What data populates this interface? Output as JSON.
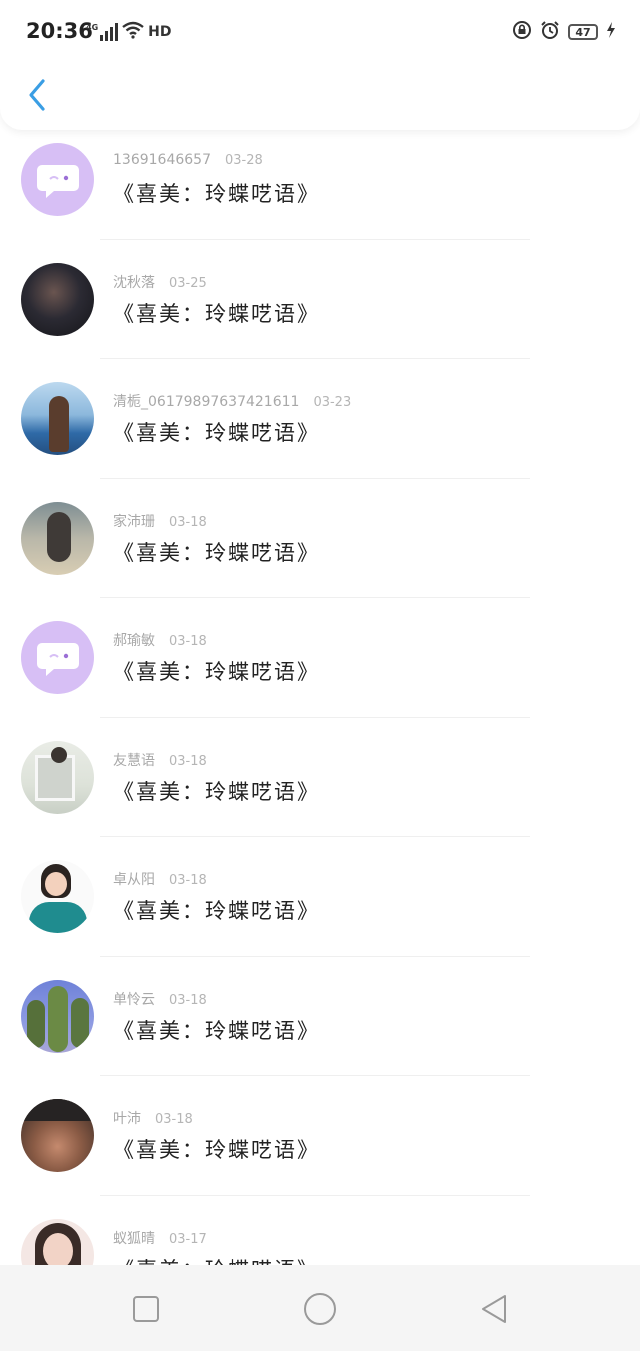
{
  "status_bar": {
    "time": "20:36",
    "network": "4G",
    "hd": "HD",
    "battery": "47"
  },
  "items": [
    {
      "author": "13691646657",
      "date": "03-28",
      "title": "《喜美：玲蝶呓语》",
      "avatar": "default-chat-avatar"
    },
    {
      "author": "沈秋落",
      "date": "03-25",
      "title": "《喜美：玲蝶呓语》",
      "avatar": "photo-avatar"
    },
    {
      "author": "清栀_06179897637421611",
      "date": "03-23",
      "title": "《喜美：玲蝶呓语》",
      "avatar": "photo-avatar"
    },
    {
      "author": "家沛珊",
      "date": "03-18",
      "title": "《喜美：玲蝶呓语》",
      "avatar": "photo-avatar"
    },
    {
      "author": "郝瑜敏",
      "date": "03-18",
      "title": "《喜美：玲蝶呓语》",
      "avatar": "default-chat-avatar"
    },
    {
      "author": "友慧语",
      "date": "03-18",
      "title": "《喜美：玲蝶呓语》",
      "avatar": "photo-avatar"
    },
    {
      "author": "卓从阳",
      "date": "03-18",
      "title": "《喜美：玲蝶呓语》",
      "avatar": "photo-avatar"
    },
    {
      "author": "单怜云",
      "date": "03-18",
      "title": "《喜美：玲蝶呓语》",
      "avatar": "photo-avatar"
    },
    {
      "author": "叶沛",
      "date": "03-18",
      "title": "《喜美：玲蝶呓语》",
      "avatar": "photo-avatar"
    },
    {
      "author": "蚁狐晴",
      "date": "03-17",
      "title": "《喜美：玲蝶呓语》",
      "avatar": "photo-avatar"
    }
  ],
  "nav": {
    "buttons": [
      "recent-apps",
      "home",
      "back"
    ]
  },
  "colors": {
    "accent": "#3a9ee4",
    "default_avatar": "#d7bff5"
  }
}
